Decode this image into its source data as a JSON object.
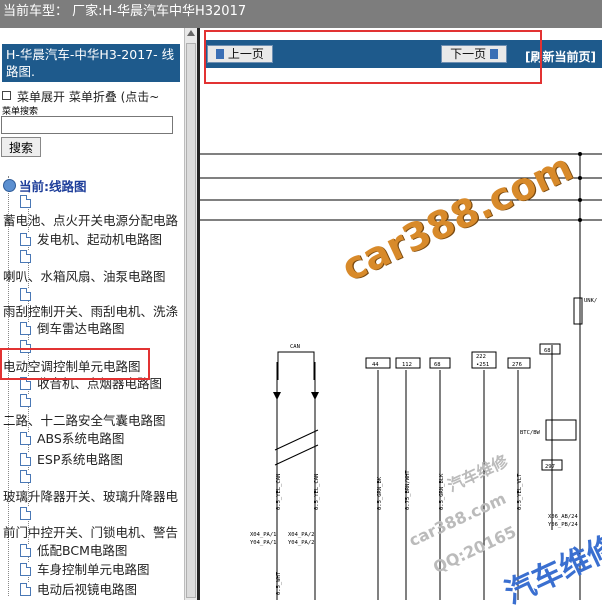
{
  "topbar": {
    "title": "当前车型：  厂家:H-华晨汽车中华H32017"
  },
  "sidebar": {
    "car_title": "H-华晨汽车-中华H3-2017- 线路图.",
    "menu_toggle": "菜单展开  菜单折叠 (点击~",
    "search_label": "菜单搜索",
    "search_value": "",
    "search_button": "搜索",
    "current_label": "当前:线路图",
    "items": [
      "蓄电池、点火开关电源分配电路",
      "发电机、起动机电路图",
      "喇叭、水箱风扇、油泵电路图",
      "雨刮控制开关、雨刮电机、洗涤",
      "倒车雷达电路图",
      "电动空调控制单元电路图",
      "收音机、点烟器电路图",
      "二路、十二路安全气囊电路图",
      "ABS系统电路图",
      "ESP系统电路图",
      "玻璃升降器开关、玻璃升降器电",
      "前门中控开关、门锁电机、警告",
      "低配BCM电路图",
      "车身控制单元电路图",
      "电动后视镜电路图"
    ]
  },
  "viewer": {
    "prev_button": "上一页",
    "next_button": "下一页",
    "refresh_button": "[刷新当前页]"
  },
  "diagram": {
    "labels": [
      "CAN",
      "44",
      "112",
      "68",
      "222",
      "•251",
      "276",
      "68",
      "UNK/",
      "BTC/BW",
      "297",
      "X06_AB/24",
      "Y06_PB/24",
      "X04_PA/1",
      "Y04_PA/1",
      "X04_PA/2",
      "Y04_PA/2",
      "0.5_WHT",
      "0.5_YEL_CAN",
      "0.5_YEL_CAN",
      "0.5_GRN_BK",
      "0.75_BRN/WHT",
      "0.5_GRN_BLK",
      "0.5_YEL_VLT"
    ]
  },
  "watermark": {
    "main": "car388.com",
    "sub1": "汽车维修",
    "sub2": "car388.com",
    "sub3": "QQ:20165",
    "sub4": "汽车维修"
  },
  "colors": {
    "nav_blue": "#1e5a8c",
    "highlight_red": "#e23232",
    "watermark_orange": "#d88a2a"
  }
}
